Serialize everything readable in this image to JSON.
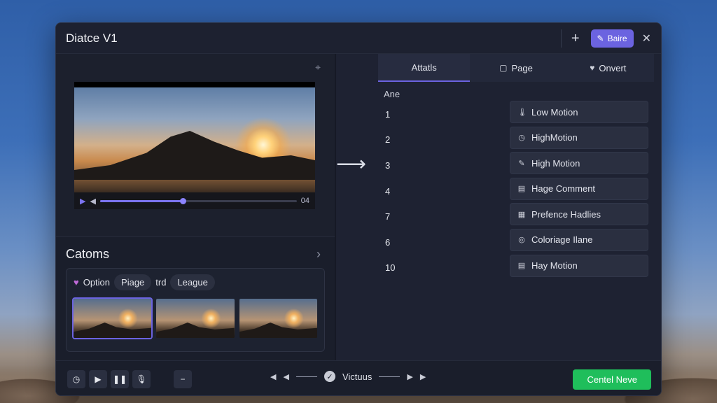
{
  "window": {
    "title": "Diatce V1"
  },
  "titlebar": {
    "add_label": "+",
    "save_label": "Baire",
    "close_label": "✕"
  },
  "player": {
    "time": "04"
  },
  "left": {
    "section_title": "Catoms",
    "option_label": "Option",
    "chips": [
      "Piage",
      "trd",
      "League"
    ]
  },
  "tabs": [
    {
      "label": "Attatls",
      "icon": ""
    },
    {
      "label": "Page",
      "icon": "clipboard-icon"
    },
    {
      "label": "Onvert",
      "icon": "heart-icon"
    }
  ],
  "list": {
    "header": "Ane",
    "numbers": [
      "1",
      "2",
      "3",
      "4",
      "7",
      "6",
      "10"
    ]
  },
  "actions": [
    {
      "label": "Low Motion",
      "icon": "thermometer-icon"
    },
    {
      "label": "HighMotion",
      "icon": "clock-icon"
    },
    {
      "label": "High Motion",
      "icon": "pen-icon"
    },
    {
      "label": "Hage Comment",
      "icon": "document-icon"
    },
    {
      "label": "Prefence Hadlies",
      "icon": "grid-icon"
    },
    {
      "label": "Coloriage Ilane",
      "icon": "palette-icon"
    },
    {
      "label": "Hay Motion",
      "icon": "document-icon"
    }
  ],
  "bottom": {
    "nav_label": "Victuus",
    "cta_label": "Centel Neve"
  },
  "colors": {
    "accent": "#6b63e0",
    "cta": "#1fbe5b"
  }
}
